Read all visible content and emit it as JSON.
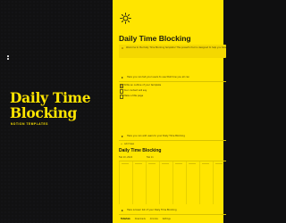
{
  "cover": {
    "title": "Daily Time Blocking",
    "subtitle": "NOTION TEMPLATES"
  },
  "page": {
    "icon": "sun-icon",
    "title": "Daily Time Blocking",
    "callout_text": "Welcome to the Daily Time Blocking template! This powerful tool is designed to help you take control of your day with better time management. this template will assist you in optimizing your schedule."
  },
  "sections": {
    "how_to_use": "Here you can tell your users to use that how you all can",
    "how_to_learn": "Here you can add users to your Daily Time Blocking",
    "how_to_view": "Here is basic list of your Daily Time Blocking"
  },
  "checklist": [
    {
      "label": "Write an outline of your template",
      "done": true
    },
    {
      "label": "Your content will say",
      "done": false
    },
    {
      "label": "Make a title page",
      "done": false
    }
  ],
  "calendar": {
    "new_view_label": "Add View",
    "title": "Daily Time Blocking",
    "dates": [
      "Feb 10, 2024",
      "Feb 11"
    ]
  },
  "footer_tabs": [
    "Tutorials",
    "Downloads",
    "All Links",
    "Settings"
  ],
  "colors": {
    "accent": "#ffe500",
    "dark_bg": "#111112",
    "text": "#1a1a10"
  }
}
